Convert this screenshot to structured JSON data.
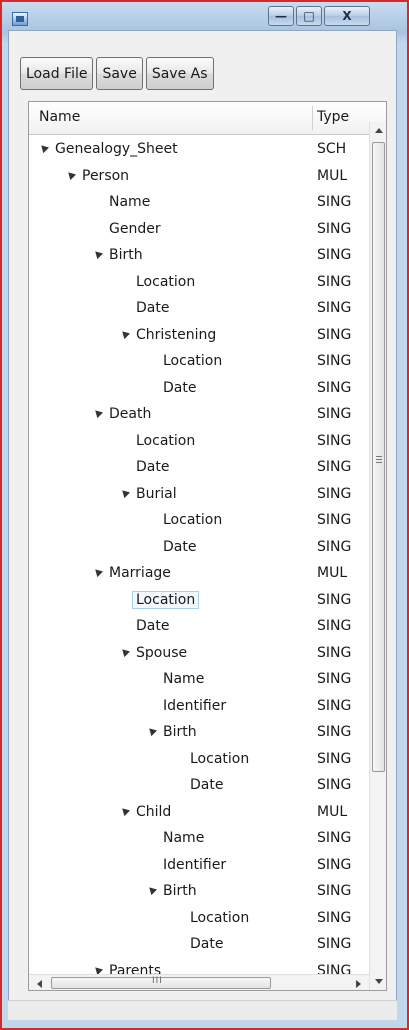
{
  "window": {
    "title": "",
    "minimize_glyph": "—",
    "maximize_glyph": "□",
    "close_glyph": "X"
  },
  "toolbar": {
    "load_label": "Load File",
    "save_label": "Save",
    "save_as_label": "Save As"
  },
  "table": {
    "columns": [
      "Name",
      "Type"
    ],
    "rows": [
      {
        "label": "Genealogy_Sheet",
        "type": "SCH",
        "level": 0,
        "expandable": true
      },
      {
        "label": "Person",
        "type": "MUL",
        "level": 1,
        "expandable": true
      },
      {
        "label": "Name",
        "type": "SING",
        "level": 2,
        "expandable": false
      },
      {
        "label": "Gender",
        "type": "SING",
        "level": 2,
        "expandable": false
      },
      {
        "label": "Birth",
        "type": "SING",
        "level": 2,
        "expandable": true
      },
      {
        "label": "Location",
        "type": "SING",
        "level": 3,
        "expandable": false
      },
      {
        "label": "Date",
        "type": "SING",
        "level": 3,
        "expandable": false
      },
      {
        "label": "Christening",
        "type": "SING",
        "level": 3,
        "expandable": true
      },
      {
        "label": "Location",
        "type": "SING",
        "level": 4,
        "expandable": false
      },
      {
        "label": "Date",
        "type": "SING",
        "level": 4,
        "expandable": false
      },
      {
        "label": "Death",
        "type": "SING",
        "level": 2,
        "expandable": true
      },
      {
        "label": "Location",
        "type": "SING",
        "level": 3,
        "expandable": false
      },
      {
        "label": "Date",
        "type": "SING",
        "level": 3,
        "expandable": false
      },
      {
        "label": "Burial",
        "type": "SING",
        "level": 3,
        "expandable": true
      },
      {
        "label": "Location",
        "type": "SING",
        "level": 4,
        "expandable": false
      },
      {
        "label": "Date",
        "type": "SING",
        "level": 4,
        "expandable": false
      },
      {
        "label": "Marriage",
        "type": "MUL",
        "level": 2,
        "expandable": true
      },
      {
        "label": "Location",
        "type": "SING",
        "level": 3,
        "expandable": false,
        "selected": true
      },
      {
        "label": "Date",
        "type": "SING",
        "level": 3,
        "expandable": false
      },
      {
        "label": "Spouse",
        "type": "SING",
        "level": 3,
        "expandable": true
      },
      {
        "label": "Name",
        "type": "SING",
        "level": 4,
        "expandable": false
      },
      {
        "label": "Identifier",
        "type": "SING",
        "level": 4,
        "expandable": false
      },
      {
        "label": "Birth",
        "type": "SING",
        "level": 4,
        "expandable": true
      },
      {
        "label": "Location",
        "type": "SING",
        "level": 5,
        "expandable": false
      },
      {
        "label": "Date",
        "type": "SING",
        "level": 5,
        "expandable": false
      },
      {
        "label": "Child",
        "type": "MUL",
        "level": 3,
        "expandable": true
      },
      {
        "label": "Name",
        "type": "SING",
        "level": 4,
        "expandable": false
      },
      {
        "label": "Identifier",
        "type": "SING",
        "level": 4,
        "expandable": false
      },
      {
        "label": "Birth",
        "type": "SING",
        "level": 4,
        "expandable": true
      },
      {
        "label": "Location",
        "type": "SING",
        "level": 5,
        "expandable": false
      },
      {
        "label": "Date",
        "type": "SING",
        "level": 5,
        "expandable": false
      },
      {
        "label": "Parents",
        "type": "SING",
        "level": 2,
        "expandable": true
      }
    ]
  },
  "hscroll": {
    "grip": "III"
  },
  "icons": {
    "app": "window-app-icon",
    "disclosure": "expanded-triangle-icon",
    "scroll_up": "scroll-up-arrow-icon",
    "scroll_down": "scroll-down-arrow-icon",
    "scroll_left": "scroll-left-arrow-icon",
    "scroll_right": "scroll-right-arrow-icon"
  },
  "colors": {
    "window_frame": "#d42a2a",
    "selection_border": "#a8d0ee"
  }
}
